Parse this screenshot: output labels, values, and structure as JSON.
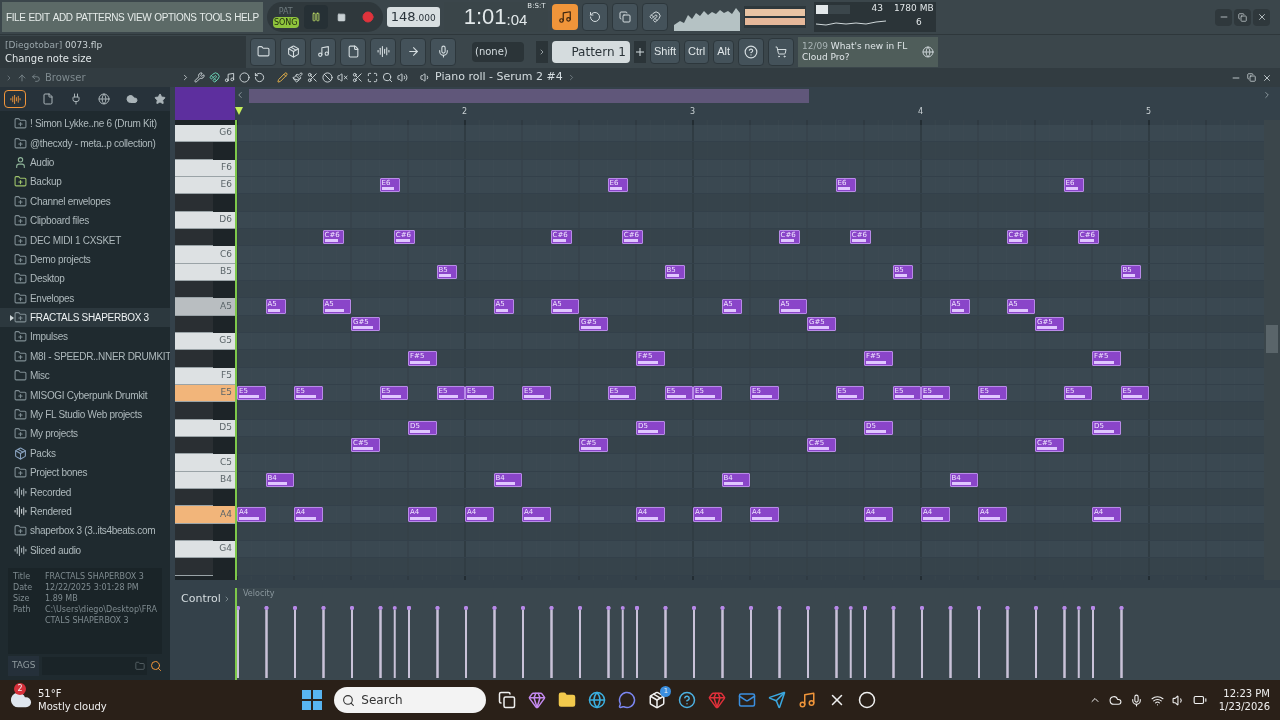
{
  "menu": [
    "FILE",
    "EDIT",
    "ADD",
    "PATTERNS",
    "VIEW",
    "OPTIONS",
    "TOOLS",
    "HELP"
  ],
  "transport": {
    "pat": "PAT",
    "song": "SONG",
    "song_mode": true,
    "playing": true,
    "tempo": "148",
    "tempo_fraction": ".000",
    "time": "1:01",
    "time_ticks": ":04",
    "time_label": "B:S:T"
  },
  "monitor": {
    "cpu": "43",
    "memory": "1780 MB",
    "polyphony": "6",
    "cpu_meter": {
      "level": 0.35
    }
  },
  "hint": {
    "project": "[Diegotobar]",
    "file": "0073.flp",
    "text": "Change note size"
  },
  "pattern_bar": {
    "channel": "(none)",
    "pattern": "Pattern 1"
  },
  "modifier_keys": [
    "Shift",
    "Ctrl",
    "Alt"
  ],
  "news": {
    "date": "12/09",
    "text": "What's new in FL Cloud Pro?"
  },
  "browser": {
    "title": "Browser",
    "items": [
      {
        "label": "! Simon Lykke..ne 6 (Drum Kit)",
        "kind": "folder",
        "selected": false
      },
      {
        "label": "@thecxdy - meta..p collection)",
        "kind": "folder",
        "selected": false
      },
      {
        "label": "Audio",
        "kind": "user",
        "selected": false
      },
      {
        "label": "Backup",
        "kind": "backup",
        "selected": false
      },
      {
        "label": "Channel envelopes",
        "kind": "folder",
        "selected": false
      },
      {
        "label": "Clipboard files",
        "kind": "folder",
        "selected": false
      },
      {
        "label": "DEC MIDI 1 CXSKET",
        "kind": "folder",
        "selected": false
      },
      {
        "label": "Demo projects",
        "kind": "folder",
        "selected": false
      },
      {
        "label": "Desktop",
        "kind": "folder",
        "selected": false
      },
      {
        "label": "Envelopes",
        "kind": "folder",
        "selected": false
      },
      {
        "label": "FRACTALS SHAPERBOX 3",
        "kind": "folder",
        "selected": true
      },
      {
        "label": "Impulses",
        "kind": "folder",
        "selected": false
      },
      {
        "label": "M8I - SPEEDR..NNER DRUMKIT",
        "kind": "folder",
        "selected": false
      },
      {
        "label": "Misc",
        "kind": "plain",
        "selected": false
      },
      {
        "label": "MISOGI Cyberpunk Drumkit",
        "kind": "folder",
        "selected": false
      },
      {
        "label": "My FL Studio Web projects",
        "kind": "folder",
        "selected": false
      },
      {
        "label": "My projects",
        "kind": "folder",
        "selected": false
      },
      {
        "label": "Packs",
        "kind": "packs",
        "selected": false
      },
      {
        "label": "Project bones",
        "kind": "folder",
        "selected": false
      },
      {
        "label": "Recorded",
        "kind": "wave",
        "selected": false
      },
      {
        "label": "Rendered",
        "kind": "render",
        "selected": false
      },
      {
        "label": "shaperbox 3 (3..its4beats.com",
        "kind": "folder",
        "selected": false
      },
      {
        "label": "Sliced audio",
        "kind": "wave",
        "selected": false
      }
    ],
    "info": [
      {
        "label": "Title",
        "value": "FRACTALS SHAPERBOX 3"
      },
      {
        "label": "Date",
        "value": "12/22/2025 3:01:28 PM"
      },
      {
        "label": "Size",
        "value": "1.89 MB"
      },
      {
        "label": "Path",
        "value": "C:\\Users\\diego\\Desktop\\FRACTALS SHAPERBOX 3"
      }
    ],
    "tags": "TAGS"
  },
  "piano_roll": {
    "title": "Piano roll - Serum 2 #4",
    "bar_numbers": [
      "2",
      "3",
      "4",
      "5"
    ],
    "keys": [
      {
        "label": "G6",
        "black": false,
        "pressed": false,
        "hovered": false
      },
      {
        "black": true,
        "pressed": false,
        "hovered": false
      },
      {
        "label": "F6",
        "black": false,
        "pressed": false,
        "hovered": false
      },
      {
        "label": "E6",
        "black": false,
        "pressed": false,
        "hovered": false,
        "notes": [
          "E6",
          "E6",
          "E6",
          "E6"
        ]
      },
      {
        "black": true,
        "pressed": false,
        "hovered": false
      },
      {
        "label": "D6",
        "black": false,
        "pressed": false,
        "hovered": false
      },
      {
        "black": true,
        "pressed": false,
        "hovered": false,
        "notes": [
          "C#6",
          "C#6",
          "C#6",
          "C#6",
          "C#6",
          "C#6",
          "C#6",
          "C#6"
        ]
      },
      {
        "label": "C6",
        "black": false,
        "pressed": false,
        "hovered": false
      },
      {
        "label": "B5",
        "black": false,
        "pressed": false,
        "hovered": false,
        "notes": [
          "B5",
          "B5",
          "B5",
          "B5"
        ]
      },
      {
        "black": true,
        "pressed": false,
        "hovered": false
      },
      {
        "label": "A5",
        "black": false,
        "pressed": false,
        "hovered": true,
        "notes": [
          "A5",
          "A5",
          "A5",
          "A5",
          "A5",
          "A5",
          "A5",
          "A5"
        ]
      },
      {
        "black": true,
        "pressed": false,
        "hovered": false,
        "notes": [
          "G#5",
          "G#5",
          "G#5",
          "G#5"
        ]
      },
      {
        "label": "G5",
        "black": false,
        "pressed": false,
        "hovered": false
      },
      {
        "black": true,
        "pressed": false,
        "hovered": false,
        "notes": [
          "F#5",
          "F#5",
          "F#5",
          "F#5"
        ]
      },
      {
        "label": "F5",
        "black": false,
        "pressed": false,
        "hovered": false
      },
      {
        "label": "E5",
        "black": false,
        "pressed": true,
        "hovered": false,
        "notes": [
          "E5",
          "E5",
          "E5",
          "E5",
          "E5",
          "E5",
          "E5",
          "E5",
          "E5",
          "E5",
          "E5",
          "E5",
          "E5",
          "E5",
          "E5",
          "E5"
        ]
      },
      {
        "black": true,
        "pressed": false,
        "hovered": false
      },
      {
        "label": "D5",
        "black": false,
        "pressed": false,
        "hovered": false,
        "notes": [
          "D5",
          "D5",
          "D5",
          "D5"
        ]
      },
      {
        "black": true,
        "pressed": false,
        "hovered": false,
        "notes": [
          "C#5",
          "C#5",
          "C#5",
          "C#5"
        ]
      },
      {
        "label": "C5",
        "black": false,
        "pressed": false,
        "hovered": false
      },
      {
        "label": "B4",
        "black": false,
        "pressed": false,
        "hovered": false,
        "notes": [
          "B4",
          "B4",
          "B4",
          "B4"
        ]
      },
      {
        "black": true,
        "pressed": false,
        "hovered": false
      },
      {
        "label": "A4",
        "black": false,
        "pressed": true,
        "hovered": false,
        "notes": [
          "A4",
          "A4",
          "A4",
          "A4",
          "A4",
          "A4",
          "A4",
          "A4",
          "A4",
          "A4",
          "A4",
          "A4"
        ]
      },
      {
        "black": true,
        "pressed": false,
        "hovered": false
      },
      {
        "label": "G4",
        "black": false,
        "pressed": false,
        "hovered": false
      },
      {
        "black": true,
        "pressed": false,
        "hovered": false
      }
    ],
    "control": {
      "label": "Control",
      "target": "Velocity"
    }
  },
  "taskbar": {
    "temperature": "51°F",
    "weather": "Mostly cloudy",
    "weather_badge": "2",
    "search": "Search",
    "store_badge": "1",
    "time": "12:23 PM",
    "date": "1/23/2026"
  }
}
